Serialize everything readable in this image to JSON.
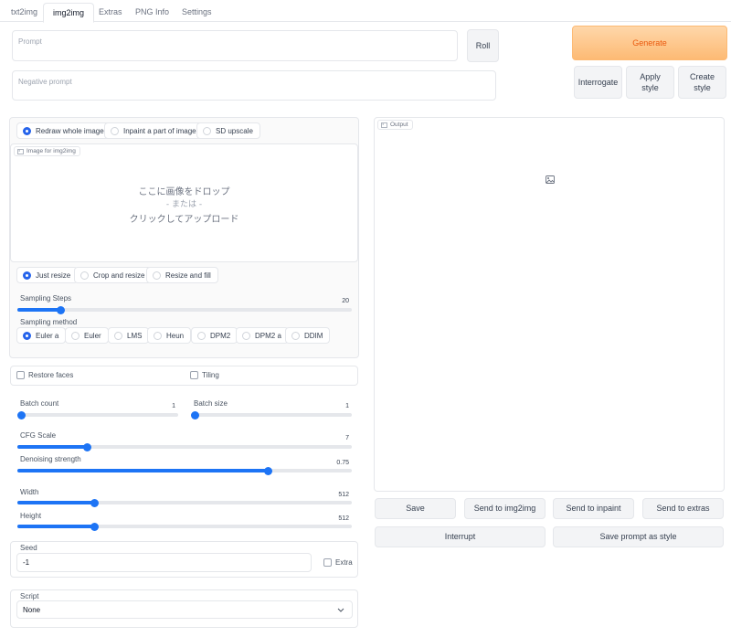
{
  "tabs": [
    "txt2img",
    "img2img",
    "Extras",
    "PNG Info",
    "Settings"
  ],
  "prompt": {
    "placeholder": "Prompt"
  },
  "negative_prompt": {
    "placeholder": "Negative prompt"
  },
  "buttons": {
    "roll": "Roll",
    "generate": "Generate",
    "interrogate": "Interrogate",
    "apply_style": "Apply style",
    "create_style": "Create style"
  },
  "mode_radios": [
    "Redraw whole image",
    "Inpaint a part of image",
    "SD upscale"
  ],
  "image_label": "Image for img2img",
  "dropzone": {
    "line1": "ここに画像をドロップ",
    "line2": "- または -",
    "line3": "クリックしてアップロード"
  },
  "resize_radios": [
    "Just resize",
    "Crop and resize",
    "Resize and fill"
  ],
  "sampling_steps": {
    "label": "Sampling Steps",
    "value": "20",
    "fraction": 0.13
  },
  "sampling_method": {
    "label": "Sampling method",
    "options": [
      "Euler a",
      "Euler",
      "LMS",
      "Heun",
      "DPM2",
      "DPM2 a",
      "DDIM"
    ]
  },
  "restore_faces": "Restore faces",
  "tiling": "Tiling",
  "batch_count": {
    "label": "Batch count",
    "value": "1",
    "fraction": 0.0
  },
  "batch_size": {
    "label": "Batch size",
    "value": "1",
    "fraction": 0.0
  },
  "cfg_scale": {
    "label": "CFG Scale",
    "value": "7",
    "fraction": 0.21
  },
  "denoising": {
    "label": "Denoising strength",
    "value": "0.75",
    "fraction": 0.75
  },
  "width": {
    "label": "Width",
    "value": "512",
    "fraction": 0.23
  },
  "height": {
    "label": "Height",
    "value": "512",
    "fraction": 0.23
  },
  "seed": {
    "label": "Seed",
    "value": "-1",
    "extra": "Extra"
  },
  "script": {
    "label": "Script",
    "value": "None"
  },
  "output": {
    "label": "Output"
  },
  "output_buttons": [
    "Save",
    "Send to img2img",
    "Send to inpaint",
    "Send to extras"
  ],
  "interrupt": "Interrupt",
  "save_prompt_style": "Save prompt as style",
  "colors": {
    "accent": "#1d74f5",
    "generate_text": "#ea580c",
    "generate_bg": "#fdba74"
  }
}
